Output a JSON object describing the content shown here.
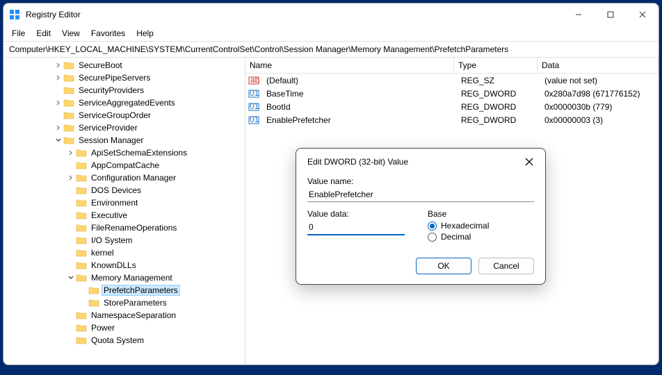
{
  "window": {
    "title": "Registry Editor"
  },
  "menus": [
    "File",
    "Edit",
    "View",
    "Favorites",
    "Help"
  ],
  "address": "Computer\\HKEY_LOCAL_MACHINE\\SYSTEM\\CurrentControlSet\\Control\\Session Manager\\Memory Management\\PrefetchParameters",
  "tree": [
    {
      "d": 4,
      "e": "c",
      "l": "SecureBoot"
    },
    {
      "d": 4,
      "e": "c",
      "l": "SecurePipeServers"
    },
    {
      "d": 4,
      "e": "",
      "l": "SecurityProviders"
    },
    {
      "d": 4,
      "e": "c",
      "l": "ServiceAggregatedEvents"
    },
    {
      "d": 4,
      "e": "",
      "l": "ServiceGroupOrder"
    },
    {
      "d": 4,
      "e": "c",
      "l": "ServiceProvider"
    },
    {
      "d": 4,
      "e": "o",
      "l": "Session Manager"
    },
    {
      "d": 5,
      "e": "c",
      "l": "ApiSetSchemaExtensions"
    },
    {
      "d": 5,
      "e": "",
      "l": "AppCompatCache"
    },
    {
      "d": 5,
      "e": "c",
      "l": "Configuration Manager"
    },
    {
      "d": 5,
      "e": "",
      "l": "DOS Devices"
    },
    {
      "d": 5,
      "e": "",
      "l": "Environment"
    },
    {
      "d": 5,
      "e": "",
      "l": "Executive"
    },
    {
      "d": 5,
      "e": "",
      "l": "FileRenameOperations"
    },
    {
      "d": 5,
      "e": "",
      "l": "I/O System"
    },
    {
      "d": 5,
      "e": "",
      "l": "kernel"
    },
    {
      "d": 5,
      "e": "",
      "l": "KnownDLLs"
    },
    {
      "d": 5,
      "e": "o",
      "l": "Memory Management"
    },
    {
      "d": 6,
      "e": "",
      "l": "PrefetchParameters",
      "sel": true
    },
    {
      "d": 6,
      "e": "",
      "l": "StoreParameters"
    },
    {
      "d": 5,
      "e": "",
      "l": "NamespaceSeparation"
    },
    {
      "d": 5,
      "e": "",
      "l": "Power"
    },
    {
      "d": 5,
      "e": "",
      "l": "Quota System"
    }
  ],
  "list": {
    "headers": {
      "name": "Name",
      "type": "Type",
      "data": "Data"
    },
    "rows": [
      {
        "icon": "sz",
        "name": "(Default)",
        "type": "REG_SZ",
        "data": "(value not set)"
      },
      {
        "icon": "dw",
        "name": "BaseTime",
        "type": "REG_DWORD",
        "data": "0x280a7d98 (671776152)"
      },
      {
        "icon": "dw",
        "name": "BootId",
        "type": "REG_DWORD",
        "data": "0x0000030b (779)"
      },
      {
        "icon": "dw",
        "name": "EnablePrefetcher",
        "type": "REG_DWORD",
        "data": "0x00000003 (3)"
      }
    ]
  },
  "dialog": {
    "title": "Edit DWORD (32-bit) Value",
    "valueNameLabel": "Value name:",
    "valueName": "EnablePrefetcher",
    "valueDataLabel": "Value data:",
    "valueData": "0",
    "baseLabel": "Base",
    "hex": "Hexadecimal",
    "dec": "Decimal",
    "ok": "OK",
    "cancel": "Cancel"
  }
}
